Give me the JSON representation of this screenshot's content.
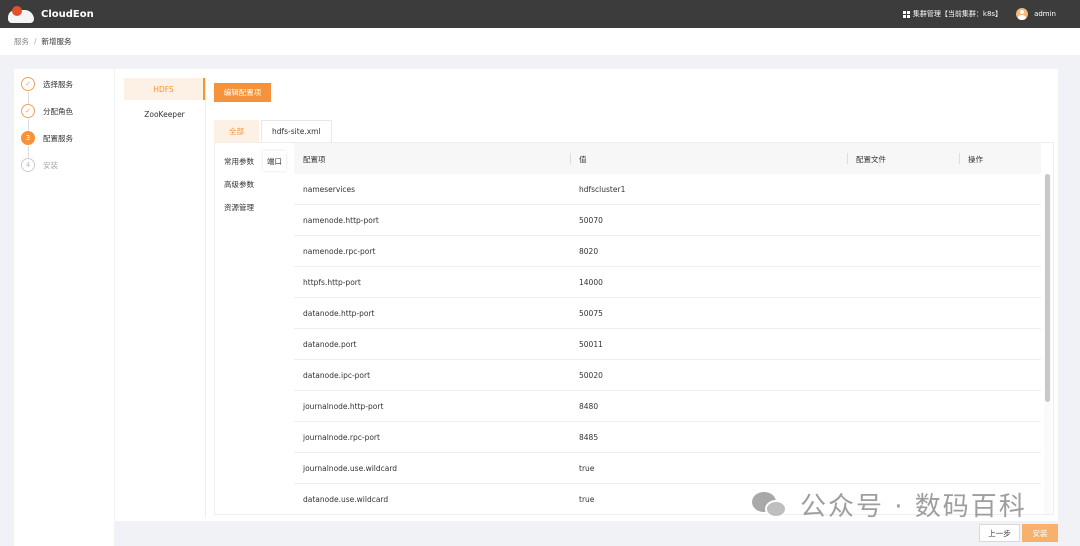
{
  "app": {
    "brand": "CloudEon"
  },
  "topbar": {
    "cluster_text": "集群管理【当前集群：k8s】",
    "user_name": "admin"
  },
  "breadcrumb": {
    "parent": "服务",
    "separator": "/",
    "current": "新增服务"
  },
  "steps": [
    {
      "icon": "✓",
      "label": "选择服务",
      "state": "done"
    },
    {
      "icon": "✓",
      "label": "分配角色",
      "state": "done"
    },
    {
      "icon": "3",
      "label": "配置服务",
      "state": "active"
    },
    {
      "icon": "4",
      "label": "安装",
      "state": "todo"
    }
  ],
  "services": [
    {
      "label": "HDFS",
      "active": true
    },
    {
      "label": "ZooKeeper",
      "active": false
    }
  ],
  "edit_button_label": "编辑配置项",
  "tabs": [
    {
      "label": "全部",
      "active": true
    },
    {
      "label": "hdfs-site.xml",
      "active": false
    }
  ],
  "param_nav": [
    "常用参数",
    "高级参数",
    "资源管理"
  ],
  "port_label": "端口",
  "table": {
    "columns": [
      "配置项",
      "值",
      "配置文件",
      "操作"
    ],
    "rows": [
      {
        "key": "nameservices",
        "value": "hdfscluster1"
      },
      {
        "key": "namenode.http-port",
        "value": "50070"
      },
      {
        "key": "namenode.rpc-port",
        "value": "8020"
      },
      {
        "key": "httpfs.http-port",
        "value": "14000"
      },
      {
        "key": "datanode.http-port",
        "value": "50075"
      },
      {
        "key": "datanode.port",
        "value": "50011"
      },
      {
        "key": "datanode.ipc-port",
        "value": "50020"
      },
      {
        "key": "journalnode.http-port",
        "value": "8480"
      },
      {
        "key": "journalnode.rpc-port",
        "value": "8485"
      },
      {
        "key": "journalnode.use.wildcard",
        "value": "true"
      },
      {
        "key": "datanode.use.wildcard",
        "value": "true"
      }
    ]
  },
  "footer": {
    "prev_label": "上一步",
    "install_label": "安装"
  },
  "watermark": {
    "text": "公众号 · 数码百科"
  },
  "colors": {
    "accent": "#f5923a",
    "topbar": "#3c3c3c"
  }
}
